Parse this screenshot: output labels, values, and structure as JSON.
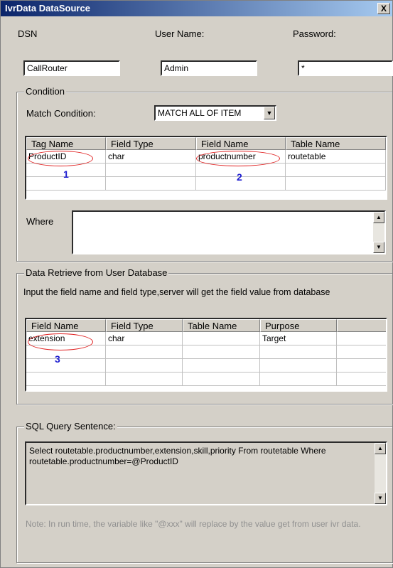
{
  "window": {
    "title": "IvrData DataSource",
    "close_glyph": "X"
  },
  "connection": {
    "dsn_label": "DSN",
    "dsn_value": "CallRouter",
    "user_label": "User Name:",
    "user_value": "Admin",
    "password_label": "Password:",
    "password_value": "*"
  },
  "condition": {
    "group_label": "Condition",
    "match_label": "Match Condition:",
    "match_value": "MATCH ALL OF ITEM",
    "columns": [
      "Tag Name",
      "Field Type",
      "Field Name",
      "Table Name"
    ],
    "rows": [
      [
        "ProductID",
        "char",
        "productnumber",
        "routetable"
      ],
      [
        "",
        "",
        "",
        ""
      ],
      [
        "",
        "",
        "",
        ""
      ]
    ],
    "annotations": [
      "1",
      "2"
    ],
    "where_label": "Where",
    "where_value": ""
  },
  "retrieve": {
    "group_label": "Data Retrieve from User Database",
    "instruction": "Input the field name and field type,server will get the field value from database",
    "columns": [
      "Field Name",
      "Field Type",
      "Table Name",
      "Purpose"
    ],
    "rows": [
      [
        "extension",
        "char",
        "",
        "Target"
      ],
      [
        "",
        "",
        "",
        ""
      ],
      [
        "",
        "",
        "",
        ""
      ],
      [
        "",
        "",
        "",
        ""
      ]
    ],
    "annotations": [
      "3"
    ]
  },
  "sql": {
    "group_label": "SQL Query Sentence:",
    "text": "Select routetable.productnumber,extension,skill,priority From routetable Where routetable.productnumber=@ProductID",
    "note": "Note: In run time, the variable like \"@xxx\" will replace by the value get from user ivr data."
  }
}
